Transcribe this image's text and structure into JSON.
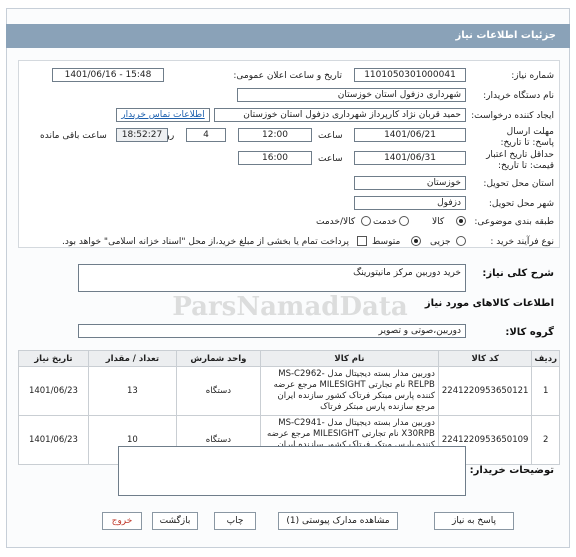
{
  "page_title": "جزئیات اطلاعات نیاز",
  "need_number": {
    "label": "شماره نیاز:",
    "value": "1101050301000041"
  },
  "announce_date": {
    "label": "تاریخ و ساعت اعلان عمومی:",
    "value": "1401/06/16 - 15:48"
  },
  "buyer_org": {
    "label": "نام دستگاه خریدار:",
    "value": "شهرداری دزفول استان خوزستان"
  },
  "requester": {
    "label": "ایجاد کننده درخواست:",
    "value": "حمید قربان نژاد کارپرداز شهرداری دزفول استان خوزستان",
    "contact_link": "اطلاعات تماس خریدار"
  },
  "reply_deadline": {
    "label": "مهلت ارسال پاسخ: تا تاریخ:",
    "date": "1401/06/21",
    "time_label": "ساعت",
    "time": "12:00",
    "days": "4",
    "days_label": "روز و",
    "remaining": "18:52:27",
    "remaining_label": "ساعت باقی مانده"
  },
  "price_validity": {
    "label": "حداقل تاریخ اعتبار قیمت: تا تاریخ:",
    "date": "1401/06/31",
    "time_label": "ساعت",
    "time": "16:00"
  },
  "delivery_province": {
    "label": "استان محل تحویل:",
    "value": "خوزستان"
  },
  "delivery_city": {
    "label": "شهر محل تحویل:",
    "value": "دزفول"
  },
  "category": {
    "label": "طبقه بندی موضوعی:",
    "options": [
      "کالا",
      "خدمت",
      "کالا/خدمت"
    ],
    "selected": "کالا"
  },
  "purchase_process": {
    "label": "نوع فرآیند خرید :",
    "options": [
      "جزیی",
      "متوسط"
    ],
    "selected": "متوسط",
    "payment_note": "پرداخت تمام یا بخشی از مبلغ خرید،از محل \"اسناد خزانه اسلامی\" خواهد بود."
  },
  "general_desc": {
    "label": "شرح کلی نیاز:",
    "value": "خرید دوربین مرکز مانیتورینگ"
  },
  "goods_section_title": "اطلاعات کالاهای مورد نیاز",
  "goods_group": {
    "label": "گروه کالا:",
    "value": "دوربین،صوتی و تصویر"
  },
  "table": {
    "headers": [
      "ردیف",
      "کد کالا",
      "نام کالا",
      "واحد شمارش",
      "تعداد / مقدار",
      "تاریخ نیاز"
    ],
    "rows": [
      {
        "row": "1",
        "code": "2241220953650121",
        "name": "دوربین مدار بسته دیجیتال مدل MS-C2962-RELPB نام تجارتی MILESIGHT مرجع عرضه کننده پارس مبتکر فرتاک کشور سازنده ایران مرجع سازنده پارس مبتکر فرتاک",
        "unit": "دستگاه",
        "qty": "13",
        "date": "1401/06/23"
      },
      {
        "row": "2",
        "code": "2241220953650109",
        "name": "دوربین مدار بسته دیجیتال مدل MS-C2941-X30RPB نام تجارتی MILESIGHT مرجع عرضه کننده پارس مبتکر فرتاک کشور سازنده ایران مرجع سازنده پارس مبتکر فرتاک",
        "unit": "دستگاه",
        "qty": "10",
        "date": "1401/06/23"
      }
    ]
  },
  "buyer_notes": {
    "label": "توضیحات خریدار:",
    "value": ""
  },
  "buttons": {
    "reply": "پاسخ به نیاز",
    "attachments": "مشاهده مدارک پیوستی (1)",
    "print": "چاپ",
    "back": "بازگشت",
    "exit": "خروج"
  },
  "watermark": "ParsNamadData",
  "colors": {
    "title_bar": "#8aa2b8",
    "link": "#1b5fae",
    "exit_button": "#c0392b"
  }
}
